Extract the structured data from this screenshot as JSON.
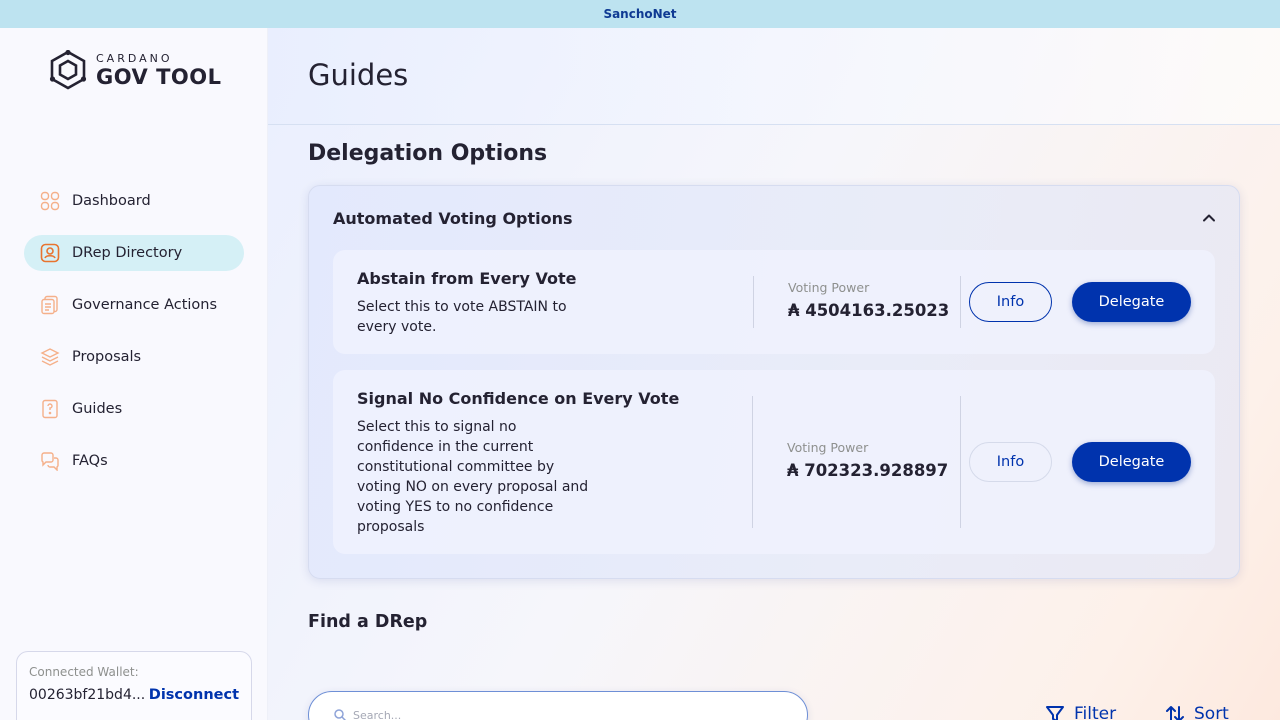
{
  "network_banner": "SanchoNet",
  "logo": {
    "small": "CARDANO",
    "big": "GOV TOOL"
  },
  "sidebar": {
    "items": [
      {
        "label": "Dashboard",
        "icon": "dashboard-icon"
      },
      {
        "label": "DRep Directory",
        "icon": "drep-directory-icon",
        "active": true
      },
      {
        "label": "Governance Actions",
        "icon": "governance-actions-icon"
      },
      {
        "label": "Proposals",
        "icon": "proposals-icon"
      },
      {
        "label": "Guides",
        "icon": "guides-icon"
      },
      {
        "label": "FAQs",
        "icon": "faqs-icon"
      }
    ],
    "wallet": {
      "label": "Connected Wallet:",
      "address": "00263bf21bd4...",
      "disconnect": "Disconnect"
    }
  },
  "page": {
    "title": "Guides",
    "section_title": "Delegation Options",
    "automated": {
      "title": "Automated Voting Options",
      "options": [
        {
          "title": "Abstain from Every Vote",
          "description": "Select this to vote ABSTAIN to every vote.",
          "voting_power_label": "Voting Power",
          "voting_power": "₳ 4504163.25023",
          "info_label": "Info",
          "delegate_label": "Delegate"
        },
        {
          "title": "Signal No Confidence on Every Vote",
          "description": "Select this to signal no confidence in the current constitutional committee by voting NO on every proposal and voting YES to no confidence proposals",
          "voting_power_label": "Voting Power",
          "voting_power": "₳ 702323.928897",
          "info_label": "Info",
          "delegate_label": "Delegate"
        }
      ]
    },
    "find_title": "Find a DRep",
    "search_placeholder": "Search...",
    "filter_label": "Filter",
    "sort_label": "Sort"
  },
  "colors": {
    "primary": "#0033ad",
    "banner": "#bde3f0",
    "active_nav": "#d5f0f6",
    "icon_accent": "#f5a06e"
  }
}
